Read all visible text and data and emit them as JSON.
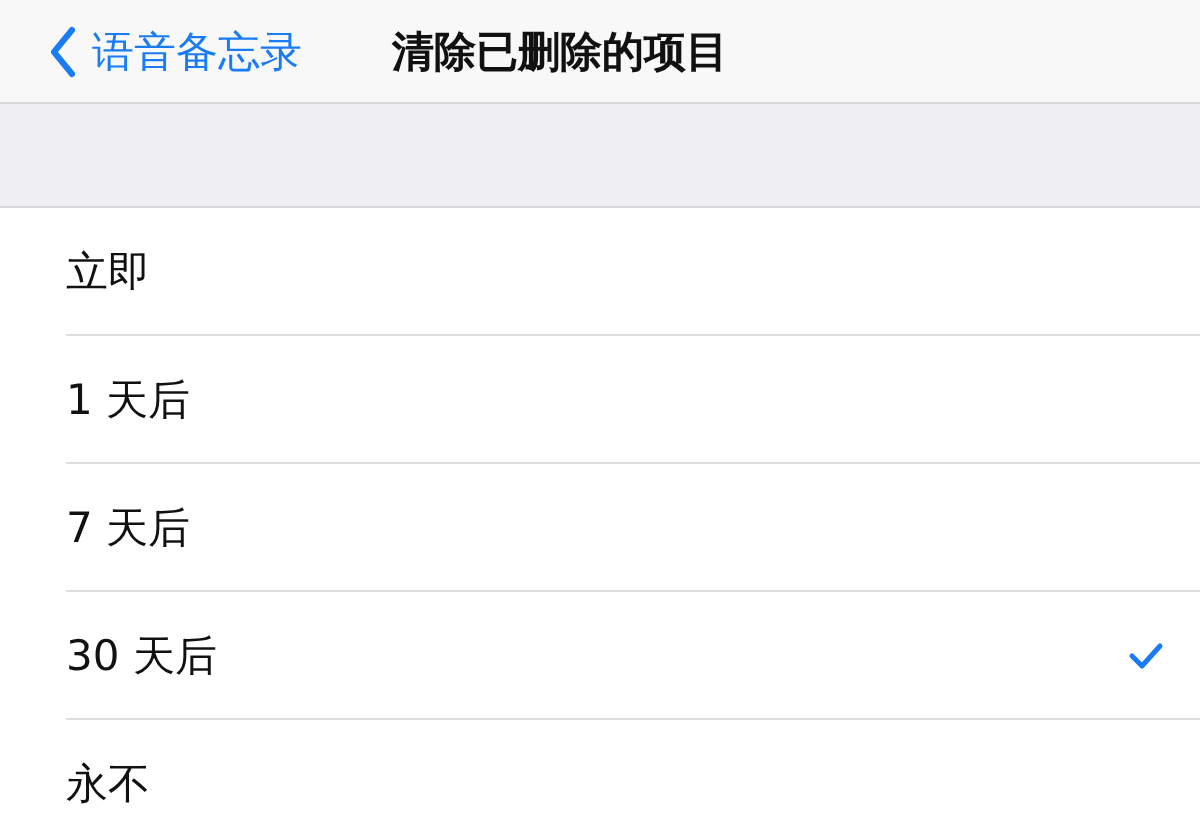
{
  "nav_bar": {
    "back_label": "语音备忘录",
    "title": "清除已删除的项目"
  },
  "options": [
    {
      "label": "立即",
      "selected": false
    },
    {
      "label": "1 天后",
      "selected": false
    },
    {
      "label": "7 天后",
      "selected": false
    },
    {
      "label": "30 天后",
      "selected": true
    },
    {
      "label": "永不",
      "selected": false
    }
  ]
}
